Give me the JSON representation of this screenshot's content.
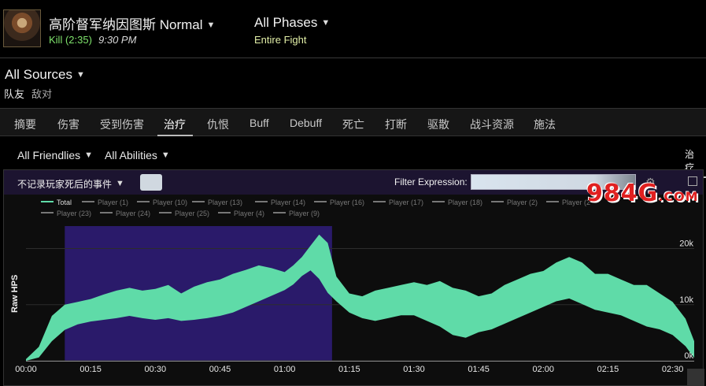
{
  "header": {
    "boss_name": "高阶督军纳因图斯 Normal",
    "kill_label": "Kill (2:35)",
    "kill_time": "9:30 PM",
    "phases_label": "All Phases",
    "phase_sub": "Entire Fight"
  },
  "sources": {
    "label": "All Sources",
    "tabs": [
      "队友",
      "敌对"
    ]
  },
  "tabs": [
    {
      "label": "摘要"
    },
    {
      "label": "伤害"
    },
    {
      "label": "受到伤害"
    },
    {
      "label": "治疗",
      "active": true
    },
    {
      "label": "仇恨"
    },
    {
      "label": "Buff"
    },
    {
      "label": "Debuff"
    },
    {
      "label": "死亡"
    },
    {
      "label": "打断"
    },
    {
      "label": "驱散"
    },
    {
      "label": "战斗资源"
    },
    {
      "label": "施法"
    }
  ],
  "filters": {
    "friendlies": "All Friendlies",
    "abilities": "All Abilities",
    "right_tab": "治疗"
  },
  "panel": {
    "death_option": "不记录玩家死后的事件",
    "filter_label": "Filter Expression:",
    "filter_value": ""
  },
  "watermark": {
    "main": "984G",
    "suffix": ".COM"
  },
  "colors": {
    "series": "#5fdba8",
    "highlight": "#2a1a6a",
    "accent": "#7fe36c"
  },
  "chart_data": {
    "type": "area",
    "ylabel": "Raw HPS",
    "legend": [
      "Total",
      "Player (1)",
      "Player (10)",
      "Player (13)",
      "Player (14)",
      "Player (16)",
      "Player (17)",
      "Player (18)",
      "Player (2)",
      "Player (2",
      "Player (23)",
      "Player (24)",
      "Player (25)",
      "Player (4)",
      "Player (9)"
    ],
    "x_ticks": [
      "00:00",
      "00:15",
      "00:30",
      "00:45",
      "01:00",
      "01:15",
      "01:30",
      "01:45",
      "02:00",
      "02:15",
      "02:30"
    ],
    "y_ticks": [
      "0k",
      "10k",
      "20k"
    ],
    "x_range_seconds": [
      0,
      155
    ],
    "y_range": [
      0,
      24000
    ],
    "highlight_seconds": [
      9,
      71
    ],
    "series": [
      {
        "name": "Total",
        "x": [
          0,
          3,
          6,
          9,
          12,
          15,
          18,
          21,
          24,
          27,
          30,
          33,
          36,
          39,
          42,
          45,
          48,
          51,
          54,
          57,
          60,
          62,
          64,
          66,
          68,
          70,
          72,
          75,
          78,
          81,
          84,
          87,
          90,
          93,
          96,
          99,
          102,
          105,
          108,
          111,
          114,
          117,
          120,
          123,
          126,
          129,
          132,
          135,
          138,
          141,
          144,
          147,
          150,
          153,
          155
        ],
        "upper": [
          300,
          2500,
          8000,
          10000,
          10500,
          11000,
          11800,
          12500,
          13000,
          12500,
          12800,
          13500,
          12000,
          13200,
          14000,
          14500,
          15500,
          16200,
          17000,
          16500,
          15800,
          17000,
          18500,
          20500,
          22500,
          21000,
          15000,
          12000,
          11500,
          12500,
          13000,
          13500,
          14000,
          13500,
          14200,
          13000,
          12500,
          11500,
          12000,
          13500,
          14500,
          15500,
          16000,
          17500,
          18500,
          17500,
          15500,
          15500,
          14500,
          13500,
          13500,
          12000,
          10500,
          7500,
          3500
        ],
        "lower": [
          0,
          600,
          3500,
          5500,
          6500,
          7000,
          7300,
          7600,
          8000,
          7600,
          7300,
          7600,
          7100,
          7300,
          7600,
          8000,
          8600,
          9600,
          10600,
          11600,
          12600,
          13600,
          15100,
          16100,
          14600,
          12100,
          10600,
          8600,
          7600,
          7100,
          7600,
          8100,
          8100,
          7100,
          6100,
          4600,
          4100,
          5100,
          5600,
          6600,
          7600,
          8600,
          9600,
          10600,
          11100,
          10100,
          9100,
          8600,
          8100,
          7100,
          6100,
          5600,
          4600,
          2600,
          500
        ]
      }
    ]
  }
}
